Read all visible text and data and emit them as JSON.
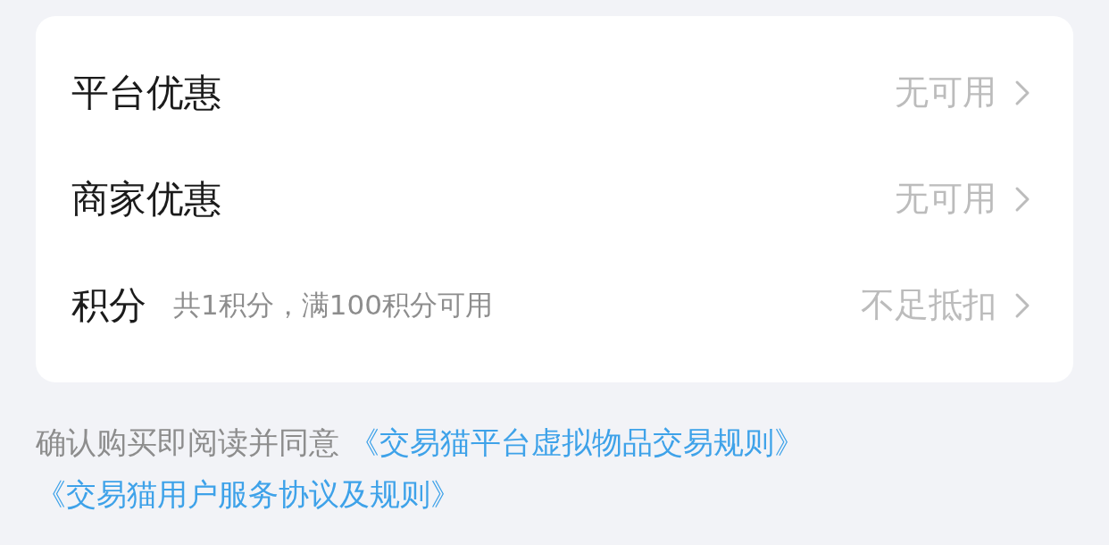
{
  "rows": [
    {
      "kind": "plain",
      "label": "平台优惠",
      "value": "无可用"
    },
    {
      "kind": "plain",
      "label": "商家优惠",
      "value": "无可用"
    },
    {
      "kind": "points",
      "label": "积分",
      "detail": "共1积分，满100积分可用",
      "value": "不足抵扣"
    }
  ],
  "agreement": {
    "text": "确认购买即阅读并同意",
    "links": [
      "《交易猫平台虚拟物品交易规则》",
      "《交易猫用户服务协议及规则》"
    ]
  }
}
